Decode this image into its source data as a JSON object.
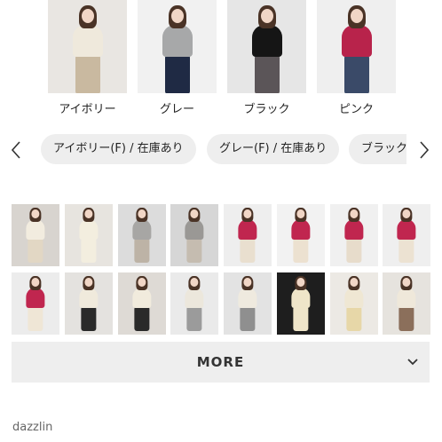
{
  "color_swatches": [
    {
      "label": "アイボリー",
      "top_color": "#efe9dc",
      "bottom_color": "#c9b9a0",
      "bg": "#e9e6e2"
    },
    {
      "label": "グレー",
      "top_color": "#a7a8a9",
      "bottom_color": "#1f2a44",
      "bg": "#f1f1f1"
    },
    {
      "label": "ブラック",
      "top_color": "#151515",
      "bottom_color": "#5b5558",
      "bg": "#e6e6e6"
    },
    {
      "label": "ピンク",
      "top_color": "#b8234b",
      "bottom_color": "#3a4a68",
      "bg": "#efefef"
    }
  ],
  "variant_chips": [
    "アイボリー(F) / 在庫あり",
    "グレー(F) / 在庫あり",
    "ブラック(F) / 在庫あり"
  ],
  "gallery": {
    "row1": [
      {
        "bg": "#d8d4cf",
        "top": "#f2ecdf",
        "bottom": "#e2d7c4"
      },
      {
        "bg": "#e7e4df",
        "top": "#f3eedf",
        "bottom": "#f3eedf"
      },
      {
        "bg": "#dcdcdc",
        "top": "#a7a6a4",
        "bottom": "#bdb3a6"
      },
      {
        "bg": "#d6d6d6",
        "top": "#9a9895",
        "bottom": "#c5bcb0"
      },
      {
        "bg": "#eeeeee",
        "top": "#c0264f",
        "bottom": "#e9dfcf"
      },
      {
        "bg": "#f2f2f2",
        "top": "#c0264f",
        "bottom": "#ece1d0"
      },
      {
        "bg": "#f0f0f0",
        "top": "#c0264f",
        "bottom": "#e7dccb"
      },
      {
        "bg": "#efefef",
        "top": "#c0264f",
        "bottom": "#ece2d2"
      }
    ],
    "row2": [
      {
        "bg": "#ececec",
        "top": "#c0264f",
        "bottom": "#efe6d6"
      },
      {
        "bg": "#e4e2df",
        "top": "#f0eadc",
        "bottom": "#2a2a2a"
      },
      {
        "bg": "#dedad5",
        "top": "#f1ebdd",
        "bottom": "#2a2a2a"
      },
      {
        "bg": "#eaeaea",
        "top": "#ece7dc",
        "bottom": "#9b9b9b"
      },
      {
        "bg": "#e3e3e3",
        "top": "#efeadf",
        "bottom": "#8f8f8f"
      },
      {
        "bg": "#1e1e1e",
        "top": "#efe5c9",
        "bottom": "#efe5c9"
      },
      {
        "bg": "#ece9e4",
        "top": "#efe7d3",
        "bottom": "#e7d7a8"
      },
      {
        "bg": "#e6e3de",
        "top": "#efe8da",
        "bottom": "#8b6f5b"
      }
    ]
  },
  "more_button": {
    "label": "MORE"
  },
  "footer": {
    "brand": "dazzlin"
  },
  "icons": {
    "prev": "chevron-left-icon",
    "next": "chevron-right-icon",
    "expand": "chevron-down-icon"
  }
}
